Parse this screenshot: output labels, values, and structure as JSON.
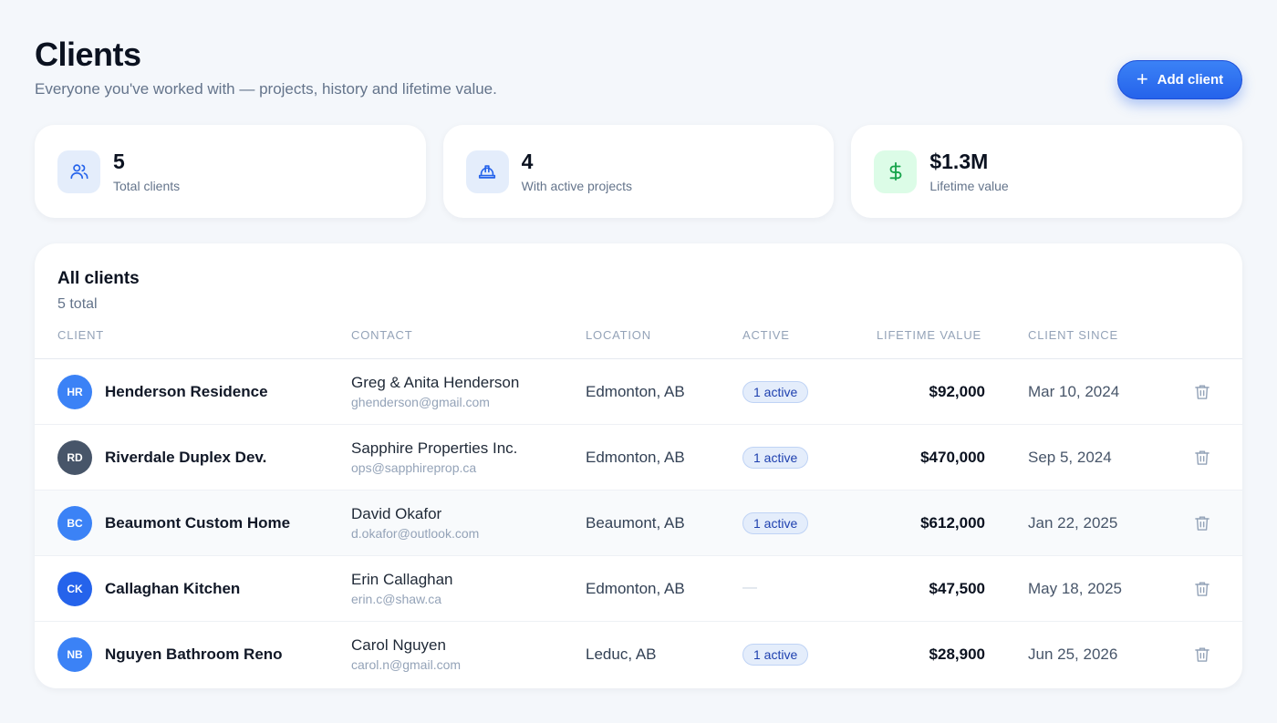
{
  "header": {
    "title": "Clients",
    "subtitle": "Everyone you've worked with — projects, history and lifetime value.",
    "add_button_label": "Add client"
  },
  "stats": [
    {
      "value": "5",
      "label": "Total clients",
      "icon": "users-icon"
    },
    {
      "value": "4",
      "label": "With active projects",
      "icon": "hard-hat-icon"
    },
    {
      "value": "$1.3M",
      "label": "Lifetime value",
      "icon": "dollar-icon"
    }
  ],
  "table": {
    "title": "All clients",
    "count_label": "5 total",
    "columns": [
      "CLIENT",
      "CONTACT",
      "LOCATION",
      "ACTIVE",
      "LIFETIME VALUE",
      "CLIENT SINCE"
    ],
    "rows": [
      {
        "initials": "HR",
        "avatar_color": "#3b82f6",
        "name": "Henderson Residence",
        "contact_name": "Greg & Anita Henderson",
        "contact_email": "ghenderson@gmail.com",
        "location": "Edmonton, AB",
        "active": "1 active",
        "value": "$92,000",
        "since": "Mar 10, 2024"
      },
      {
        "initials": "RD",
        "avatar_color": "#475569",
        "name": "Riverdale Duplex Dev.",
        "contact_name": "Sapphire Properties Inc.",
        "contact_email": "ops@sapphireprop.ca",
        "location": "Edmonton, AB",
        "active": "1 active",
        "value": "$470,000",
        "since": "Sep 5, 2024"
      },
      {
        "initials": "BC",
        "avatar_color": "#3b82f6",
        "name": "Beaumont Custom Home",
        "contact_name": "David Okafor",
        "contact_email": "d.okafor@outlook.com",
        "location": "Beaumont, AB",
        "active": "1 active",
        "value": "$612,000",
        "since": "Jan 22, 2025"
      },
      {
        "initials": "CK",
        "avatar_color": "#2563eb",
        "name": "Callaghan Kitchen",
        "contact_name": "Erin Callaghan",
        "contact_email": "erin.c@shaw.ca",
        "location": "Edmonton, AB",
        "active": "—",
        "value": "$47,500",
        "since": "May 18, 2025"
      },
      {
        "initials": "NB",
        "avatar_color": "#3b82f6",
        "name": "Nguyen Bathroom Reno",
        "contact_name": "Carol Nguyen",
        "contact_email": "carol.n@gmail.com",
        "location": "Leduc, AB",
        "active": "1 active",
        "value": "$28,900",
        "since": "Jun 25, 2026"
      }
    ]
  }
}
